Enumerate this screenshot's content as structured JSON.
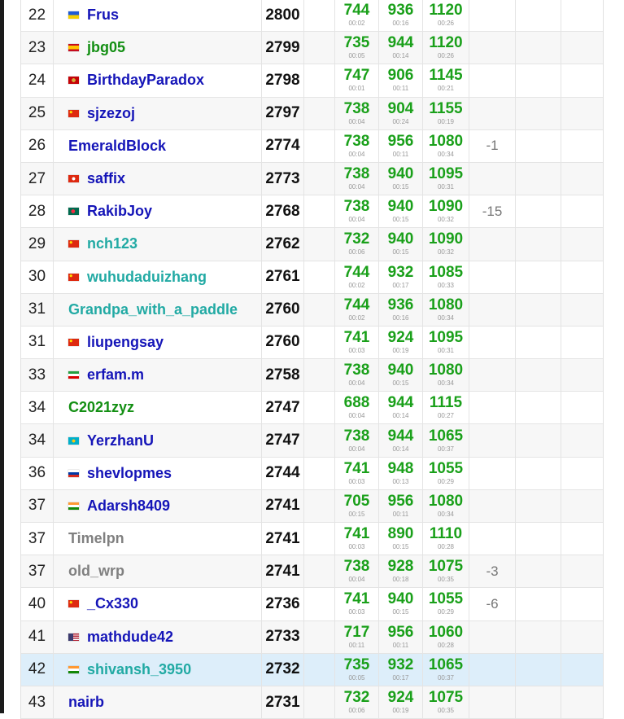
{
  "colors": {
    "legendary_grandmaster_red": "#ff0000",
    "grandmaster_red": "#ff0000",
    "master_orange": "#ff8c00",
    "candidate_master_violet": "#aa00aa",
    "expert_blue": "#1515b8",
    "specialist_cyan": "#22aaa4",
    "pupil_green": "#138f13",
    "newbie_gray": "#808080",
    "accepted_green": "#1aa01a",
    "highlight_row": "#ddeefa"
  },
  "rows": [
    {
      "rank": "22",
      "flag": "ukraine-flag-icon",
      "handle": "Frus",
      "handle_color": "#1515b8",
      "rating": "2800",
      "problems": [
        {
          "points": "744",
          "time": "00:02"
        },
        {
          "points": "936",
          "time": "00:16"
        },
        {
          "points": "1120",
          "time": "00:26"
        }
      ],
      "hacks": ""
    },
    {
      "rank": "23",
      "flag": "spain-flag-icon",
      "handle": "jbg05",
      "handle_color": "#138f13",
      "rating": "2799",
      "problems": [
        {
          "points": "735",
          "time": "00:05"
        },
        {
          "points": "944",
          "time": "00:14"
        },
        {
          "points": "1120",
          "time": "00:26"
        }
      ],
      "hacks": ""
    },
    {
      "rank": "24",
      "flag": "montenegro-flag-icon",
      "handle": "BirthdayParadox",
      "handle_color": "#1515b8",
      "rating": "2798",
      "problems": [
        {
          "points": "747",
          "time": "00:01"
        },
        {
          "points": "906",
          "time": "00:11"
        },
        {
          "points": "1145",
          "time": "00:21"
        }
      ],
      "hacks": ""
    },
    {
      "rank": "25",
      "flag": "china-flag-icon",
      "handle": "sjzezoj",
      "handle_color": "#1515b8",
      "rating": "2797",
      "problems": [
        {
          "points": "738",
          "time": "00:04"
        },
        {
          "points": "904",
          "time": "00:24"
        },
        {
          "points": "1155",
          "time": "00:19"
        }
      ],
      "hacks": ""
    },
    {
      "rank": "26",
      "flag": "",
      "handle": "EmeraldBlock",
      "handle_color": "#1515b8",
      "rating": "2774",
      "problems": [
        {
          "points": "738",
          "time": "00:04"
        },
        {
          "points": "956",
          "time": "00:11"
        },
        {
          "points": "1080",
          "time": "00:34"
        }
      ],
      "hacks": "-1"
    },
    {
      "rank": "27",
      "flag": "hongkong-flag-icon",
      "handle": "saffix",
      "handle_color": "#1515b8",
      "rating": "2773",
      "problems": [
        {
          "points": "738",
          "time": "00:04"
        },
        {
          "points": "940",
          "time": "00:15"
        },
        {
          "points": "1095",
          "time": "00:31"
        }
      ],
      "hacks": ""
    },
    {
      "rank": "28",
      "flag": "bangladesh-flag-icon",
      "handle": "RakibJoy",
      "handle_color": "#1515b8",
      "rating": "2768",
      "problems": [
        {
          "points": "738",
          "time": "00:04"
        },
        {
          "points": "940",
          "time": "00:15"
        },
        {
          "points": "1090",
          "time": "00:32"
        }
      ],
      "hacks": "-15"
    },
    {
      "rank": "29",
      "flag": "china-flag-icon",
      "handle": "nch123",
      "handle_color": "#22aaa4",
      "rating": "2762",
      "problems": [
        {
          "points": "732",
          "time": "00:06"
        },
        {
          "points": "940",
          "time": "00:15"
        },
        {
          "points": "1090",
          "time": "00:32"
        }
      ],
      "hacks": ""
    },
    {
      "rank": "30",
      "flag": "china-flag-icon",
      "handle": "wuhudaduizhang",
      "handle_color": "#22aaa4",
      "rating": "2761",
      "problems": [
        {
          "points": "744",
          "time": "00:02"
        },
        {
          "points": "932",
          "time": "00:17"
        },
        {
          "points": "1085",
          "time": "00:33"
        }
      ],
      "hacks": ""
    },
    {
      "rank": "31",
      "flag": "",
      "handle": "Grandpa_with_a_paddle",
      "handle_color": "#22aaa4",
      "rating": "2760",
      "problems": [
        {
          "points": "744",
          "time": "00:02"
        },
        {
          "points": "936",
          "time": "00:16"
        },
        {
          "points": "1080",
          "time": "00:34"
        }
      ],
      "hacks": ""
    },
    {
      "rank": "31",
      "flag": "china-flag-icon",
      "handle": "liupengsay",
      "handle_color": "#1515b8",
      "rating": "2760",
      "problems": [
        {
          "points": "741",
          "time": "00:03"
        },
        {
          "points": "924",
          "time": "00:19"
        },
        {
          "points": "1095",
          "time": "00:31"
        }
      ],
      "hacks": ""
    },
    {
      "rank": "33",
      "flag": "iran-flag-icon",
      "handle": "erfam.m",
      "handle_color": "#1515b8",
      "rating": "2758",
      "problems": [
        {
          "points": "738",
          "time": "00:04"
        },
        {
          "points": "940",
          "time": "00:15"
        },
        {
          "points": "1080",
          "time": "00:34"
        }
      ],
      "hacks": ""
    },
    {
      "rank": "34",
      "flag": "",
      "handle": "C2021zyz",
      "handle_color": "#138f13",
      "rating": "2747",
      "problems": [
        {
          "points": "688",
          "time": "00:04"
        },
        {
          "points": "944",
          "time": "00:14"
        },
        {
          "points": "1115",
          "time": "00:27"
        }
      ],
      "hacks": ""
    },
    {
      "rank": "34",
      "flag": "kazakhstan-flag-icon",
      "handle": "YerzhanU",
      "handle_color": "#1515b8",
      "rating": "2747",
      "problems": [
        {
          "points": "738",
          "time": "00:04"
        },
        {
          "points": "944",
          "time": "00:14"
        },
        {
          "points": "1065",
          "time": "00:37"
        }
      ],
      "hacks": ""
    },
    {
      "rank": "36",
      "flag": "russia-flag-icon",
      "handle": "shevlopmes",
      "handle_color": "#1515b8",
      "rating": "2744",
      "problems": [
        {
          "points": "741",
          "time": "00:03"
        },
        {
          "points": "948",
          "time": "00:13"
        },
        {
          "points": "1055",
          "time": "00:29"
        }
      ],
      "hacks": ""
    },
    {
      "rank": "37",
      "flag": "india-flag-icon",
      "handle": "Adarsh8409",
      "handle_color": "#1515b8",
      "rating": "2741",
      "problems": [
        {
          "points": "705",
          "time": "00:15"
        },
        {
          "points": "956",
          "time": "00:11"
        },
        {
          "points": "1080",
          "time": "00:34"
        }
      ],
      "hacks": ""
    },
    {
      "rank": "37",
      "flag": "",
      "handle": "Timelpn",
      "handle_color": "#808080",
      "rating": "2741",
      "problems": [
        {
          "points": "741",
          "time": "00:03"
        },
        {
          "points": "890",
          "time": "00:15"
        },
        {
          "points": "1110",
          "time": "00:28"
        }
      ],
      "hacks": ""
    },
    {
      "rank": "37",
      "flag": "",
      "handle": "old_wrp",
      "handle_color": "#808080",
      "rating": "2741",
      "problems": [
        {
          "points": "738",
          "time": "00:04"
        },
        {
          "points": "928",
          "time": "00:18"
        },
        {
          "points": "1075",
          "time": "00:35"
        }
      ],
      "hacks": "-3"
    },
    {
      "rank": "40",
      "flag": "china-flag-icon",
      "handle": "_Cx330",
      "handle_color": "#1515b8",
      "rating": "2736",
      "problems": [
        {
          "points": "741",
          "time": "00:03"
        },
        {
          "points": "940",
          "time": "00:15"
        },
        {
          "points": "1055",
          "time": "00:29"
        }
      ],
      "hacks": "-6"
    },
    {
      "rank": "41",
      "flag": "usa-flag-icon",
      "handle": "mathdude42",
      "handle_color": "#1515b8",
      "rating": "2733",
      "problems": [
        {
          "points": "717",
          "time": "00:11"
        },
        {
          "points": "956",
          "time": "00:11"
        },
        {
          "points": "1060",
          "time": "00:28"
        }
      ],
      "hacks": ""
    },
    {
      "rank": "42",
      "flag": "india-flag-icon",
      "handle": "shivansh_3950",
      "handle_color": "#22aaa4",
      "rating": "2732",
      "problems": [
        {
          "points": "735",
          "time": "00:05"
        },
        {
          "points": "932",
          "time": "00:17"
        },
        {
          "points": "1065",
          "time": "00:37"
        }
      ],
      "hacks": "",
      "highlight": true
    },
    {
      "rank": "43",
      "flag": "",
      "handle": "nairb",
      "handle_color": "#1515b8",
      "rating": "2731",
      "problems": [
        {
          "points": "732",
          "time": "00:06"
        },
        {
          "points": "924",
          "time": "00:19"
        },
        {
          "points": "1075",
          "time": "00:35"
        }
      ],
      "hacks": ""
    }
  ]
}
